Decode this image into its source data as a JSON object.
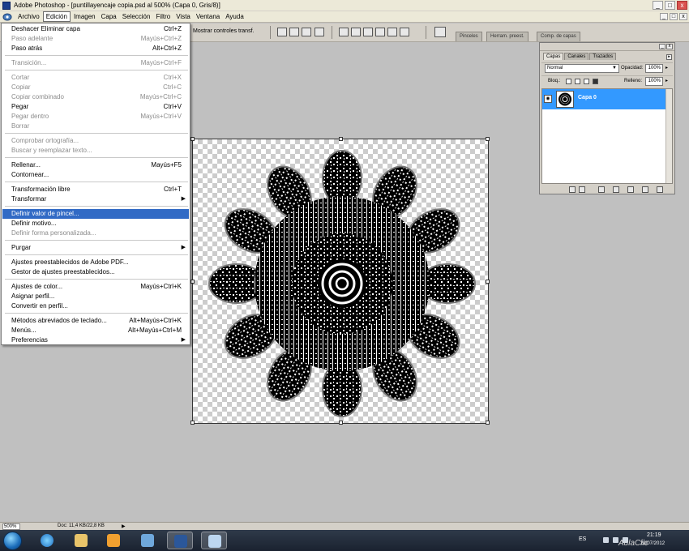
{
  "window": {
    "title": "Adobe Photoshop - [puntillayencaje copia.psd al 500% (Capa 0, Gris/8)]",
    "controls": {
      "minimize": "_",
      "maximize": "□",
      "close": "x"
    }
  },
  "menubar": {
    "items": [
      "Archivo",
      "Edición",
      "Imagen",
      "Capa",
      "Selección",
      "Filtro",
      "Vista",
      "Ventana",
      "Ayuda"
    ],
    "active_index": 1
  },
  "options_bar": {
    "label": "Mostrar controles transf."
  },
  "panel_well_tabs": [
    "Pinceles",
    "Herram. preest.",
    "Comp. de capas"
  ],
  "edit_menu": {
    "items": [
      {
        "label": "Deshacer Eliminar capa",
        "shortcut": "Ctrl+Z",
        "state": "enabled"
      },
      {
        "label": "Paso adelante",
        "shortcut": "Mayús+Ctrl+Z",
        "state": "disabled"
      },
      {
        "label": "Paso atrás",
        "shortcut": "Alt+Ctrl+Z",
        "state": "enabled"
      },
      {
        "label": "Transición...",
        "shortcut": "Mayús+Ctrl+F",
        "state": "disabled"
      },
      {
        "label": "Cortar",
        "shortcut": "Ctrl+X",
        "state": "disabled"
      },
      {
        "label": "Copiar",
        "shortcut": "Ctrl+C",
        "state": "disabled"
      },
      {
        "label": "Copiar combinado",
        "shortcut": "Mayús+Ctrl+C",
        "state": "disabled"
      },
      {
        "label": "Pegar",
        "shortcut": "Ctrl+V",
        "state": "enabled"
      },
      {
        "label": "Pegar dentro",
        "shortcut": "Mayús+Ctrl+V",
        "state": "disabled"
      },
      {
        "label": "Borrar",
        "shortcut": "",
        "state": "disabled"
      },
      {
        "label": "Comprobar ortografía...",
        "shortcut": "",
        "state": "disabled"
      },
      {
        "label": "Buscar y reemplazar texto...",
        "shortcut": "",
        "state": "disabled"
      },
      {
        "label": "Rellenar...",
        "shortcut": "Mayús+F5",
        "state": "enabled"
      },
      {
        "label": "Contornear...",
        "shortcut": "",
        "state": "enabled"
      },
      {
        "label": "Transformación libre",
        "shortcut": "Ctrl+T",
        "state": "enabled"
      },
      {
        "label": "Transformar",
        "shortcut": "",
        "state": "enabled",
        "submenu": true
      },
      {
        "label": "Definir valor de pincel...",
        "shortcut": "",
        "state": "highlighted"
      },
      {
        "label": "Definir motivo...",
        "shortcut": "",
        "state": "enabled"
      },
      {
        "label": "Definir forma personalizada...",
        "shortcut": "",
        "state": "disabled"
      },
      {
        "label": "Purgar",
        "shortcut": "",
        "state": "enabled",
        "submenu": true
      },
      {
        "label": "Ajustes preestablecidos de Adobe PDF...",
        "shortcut": "",
        "state": "enabled"
      },
      {
        "label": "Gestor de ajustes preestablecidos...",
        "shortcut": "",
        "state": "enabled"
      },
      {
        "label": "Ajustes de color...",
        "shortcut": "Mayús+Ctrl+K",
        "state": "enabled"
      },
      {
        "label": "Asignar perfil...",
        "shortcut": "",
        "state": "enabled"
      },
      {
        "label": "Convertir en perfil...",
        "shortcut": "",
        "state": "enabled"
      },
      {
        "label": "Métodos abreviados de teclado...",
        "shortcut": "Alt+Mayús+Ctrl+K",
        "state": "enabled"
      },
      {
        "label": "Menús...",
        "shortcut": "Alt+Mayús+Ctrl+M",
        "state": "enabled"
      },
      {
        "label": "Preferencias",
        "shortcut": "",
        "state": "enabled",
        "submenu": true
      }
    ]
  },
  "layers_panel": {
    "tabs": [
      "Capas",
      "Canales",
      "Trazados"
    ],
    "active_tab": "Capas",
    "blend_mode": "Normal",
    "opacity_label": "Opacidad:",
    "opacity_value": "100%",
    "lock_label": "Bloq.:",
    "fill_label": "Relleno:",
    "fill_value": "100%",
    "layers": [
      {
        "name": "Capa 0",
        "visible": true,
        "selected": true
      }
    ]
  },
  "statusbar": {
    "zoom": "500%",
    "doc_info": "Doc: 11,4 KB/22,8 KB"
  },
  "taskbar": {
    "language": "ES",
    "time": "21:19",
    "date": "29/07/2012"
  },
  "watermark": "AulaClic",
  "icons": [
    "windows-start-icon",
    "internet-explorer-icon",
    "windows-explorer-icon",
    "media-player-icon",
    "paint-icon",
    "photoshop-icon",
    "feather-icon"
  ]
}
